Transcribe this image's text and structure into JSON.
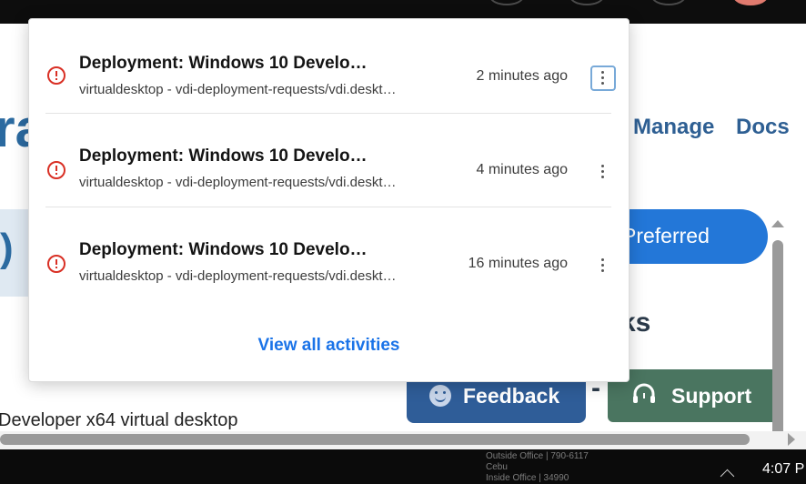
{
  "background": {
    "nav": {
      "manage": "Manage",
      "docs": "Docs"
    },
    "preferred_label": "Preferred",
    "bottom_text": "Developer x64 virtual desktop",
    "feedback_label": "Feedback",
    "support_label": "Support"
  },
  "notifications": {
    "items": [
      {
        "title": "Deployment: Windows 10 Develo…",
        "subtitle": "virtualdesktop - vdi-deployment-requests/vdi.deskt…",
        "time": "2 minutes ago",
        "status": "error"
      },
      {
        "title": "Deployment: Windows 10 Develo…",
        "subtitle": "virtualdesktop - vdi-deployment-requests/vdi.deskt…",
        "time": "4 minutes ago",
        "status": "error"
      },
      {
        "title": "Deployment: Windows 10 Develo…",
        "subtitle": "virtualdesktop - vdi-deployment-requests/vdi.deskt…",
        "time": "16 minutes ago",
        "status": "error"
      }
    ],
    "view_all": "View all activities"
  },
  "taskbar": {
    "info_line1": "Outside Office | 790-6117",
    "info_line2": "Cebu",
    "info_line3": "Inside Office | 34990",
    "clock": "4:07 P"
  },
  "colors": {
    "error": "#d93025",
    "link": "#1a73e8",
    "feedback_bg": "#2f5d98",
    "support_bg": "#4a7560",
    "preferred_bg": "#2377d8"
  }
}
